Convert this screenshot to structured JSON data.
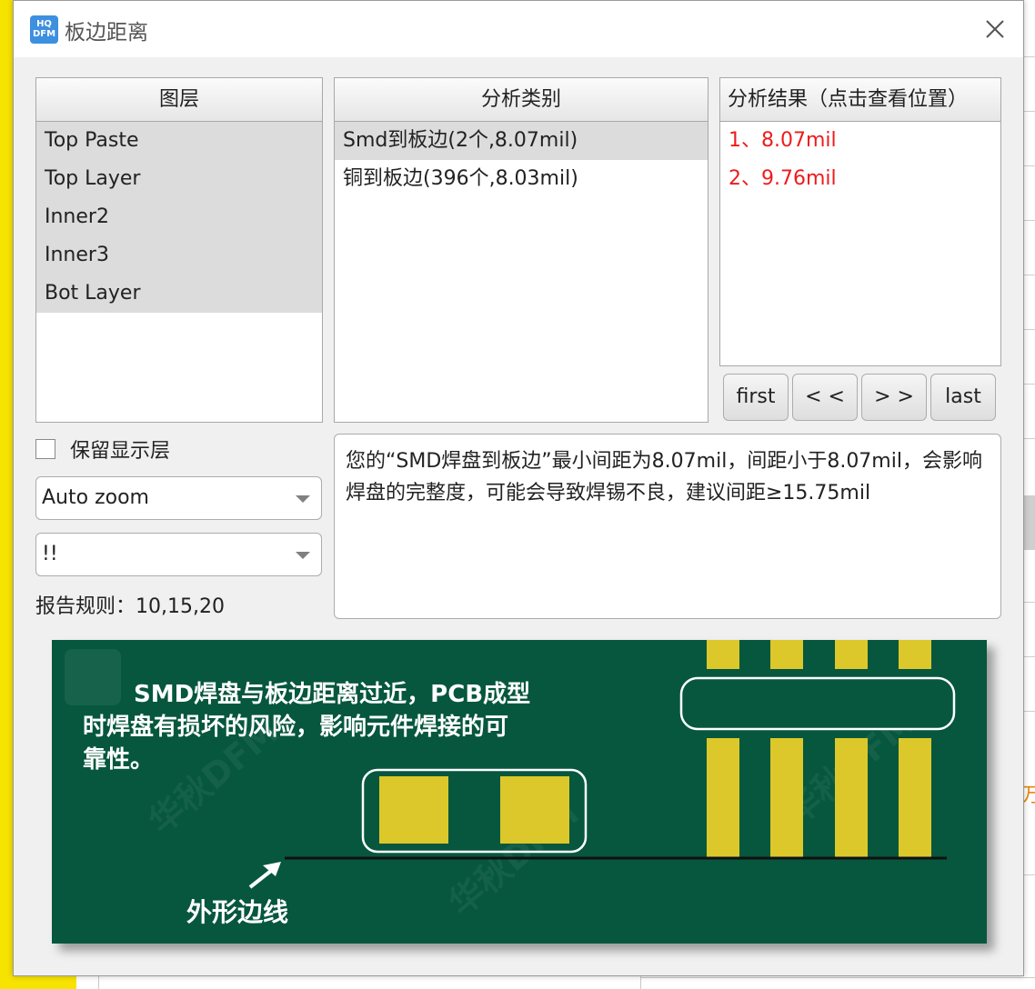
{
  "window": {
    "title": "板边距离",
    "icon_text": "HQ DFM"
  },
  "layers": {
    "header": "图层",
    "items": [
      "Top Paste",
      "Top Layer",
      "Inner2",
      "Inner3",
      "Bot Layer"
    ]
  },
  "categories": {
    "header": "分析类别",
    "items": [
      "Smd到板边(2个,8.07mil)",
      "铜到板边(396个,8.03mil)"
    ],
    "selected_index": 0
  },
  "results": {
    "header": "分析结果（点击查看位置）",
    "items": [
      "1、8.07mil",
      "2、9.76mil"
    ],
    "color": "#ee1c1c"
  },
  "nav": {
    "first": "first",
    "prev": "< <",
    "next": "> >",
    "last": "last"
  },
  "keep_layer": {
    "label": "保留显示层",
    "checked": false
  },
  "zoom_select": {
    "value": "Auto zoom"
  },
  "filter_select": {
    "value": "!!"
  },
  "report_rule": "报告规则：10,15,20",
  "description": "您的“SMD焊盘到板边”最小间距为8.07mil，间距小于8.07mil，会影响焊盘的完整度，可能会导致焊锡不良，建议间距≥15.75mil",
  "illustration": {
    "line1": "SMD焊盘与板边距离过近，PCB成型",
    "line2": "时焊盘有损坏的风险，影响元件焊接的可",
    "line3": "靠性。",
    "edge_label": "外形边线",
    "watermark": "华秋DFM",
    "logo_text": "DFM",
    "colors": {
      "board": "#06573d",
      "pad": "#dcc82a"
    }
  },
  "background": {
    "orange_char": "万"
  }
}
